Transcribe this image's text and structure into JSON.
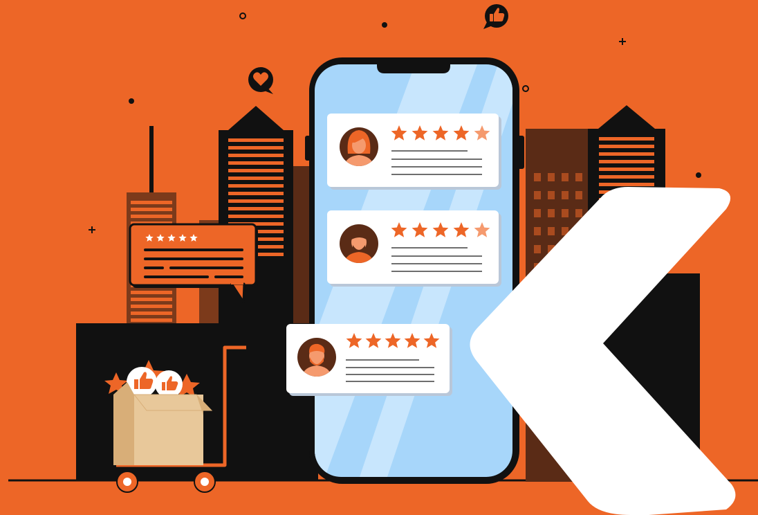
{
  "colors": {
    "background": "#ED6627",
    "dark": "#0B0B0B",
    "building_brown": "#5A2B16",
    "building_mid": "#7C3A1B",
    "phone_screen": "#A7D6FA",
    "phone_glare": "#C8E6FD",
    "card": "#FFFFFF",
    "card_shadow": "#B9C7D8",
    "star": "#ED6627",
    "star_light": "#F59A6E",
    "text_line": "#6E6E6E",
    "box_light": "#E8C89A",
    "box_dark": "#D8AE78",
    "chevron": "#FFFFFF"
  },
  "icons": {
    "like_bubble": "thumbs-up-icon",
    "heart_bubble": "heart-icon",
    "reviewer_1": "woman-avatar-icon",
    "reviewer_2": "man-avatar-icon",
    "reviewer_3": "bearded-man-avatar-icon",
    "brand_mark": "chevron-left-logo"
  },
  "reviews": [
    {
      "avatar": "woman-avatar-icon",
      "rating": 4.5
    },
    {
      "avatar": "man-avatar-icon",
      "rating": 4.5
    },
    {
      "avatar": "bearded-man-avatar-icon",
      "rating": 5
    }
  ],
  "speech_bubble_rating": 5
}
